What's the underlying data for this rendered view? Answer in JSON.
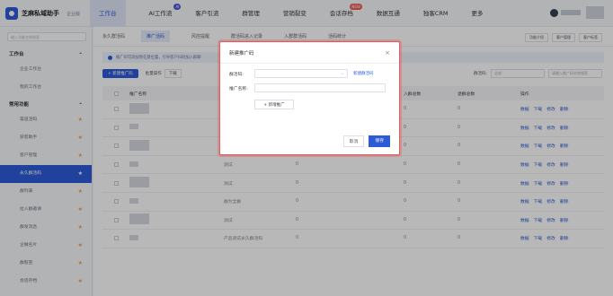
{
  "app": {
    "name": "芝麻私域助手",
    "subtitle": "企业版"
  },
  "top_nav": [
    {
      "label": "工作台",
      "badge": ""
    },
    {
      "label": "AI工作流",
      "badge": "AI"
    },
    {
      "label": "客户引流",
      "badge": ""
    },
    {
      "label": "群管理",
      "badge": ""
    },
    {
      "label": "营销裂变",
      "badge": ""
    },
    {
      "label": "会话存档",
      "badge": "NEW"
    },
    {
      "label": "数据互通",
      "badge": ""
    },
    {
      "label": "独客CRM",
      "badge": ""
    },
    {
      "label": "更多",
      "badge": ""
    }
  ],
  "sidebar": {
    "search_placeholder": "输入功能名称搜索",
    "groups": [
      {
        "title": "工作台",
        "items": [
          "企业工作台",
          "我的工作台"
        ]
      },
      {
        "title": "常用功能",
        "items": [
          "渠道活码",
          "获客助手",
          "客户管理",
          "永久群活码",
          "群列表",
          "拉人群邀请",
          "群发消息",
          "企微名片",
          "群裂变",
          "会话存档"
        ]
      }
    ],
    "active_item": "永久群活码"
  },
  "content": {
    "tabs": [
      "永久群活码",
      "推广活码",
      "风控提醒",
      "群活码进入记录",
      "入群群活码",
      "活码统计"
    ],
    "right_links": [
      "功能介绍",
      "客户管理",
      "客户标签"
    ],
    "notice": "推广码可添加到任意位置，引导客户扫码加入群聊",
    "toolbar": {
      "new_button": "+ 新建推广码",
      "batch_label": "批量操作",
      "download_label": "下载",
      "filter_label": "群活码:",
      "filter_value": "全部",
      "search_placeholder": "请输入推广码名称搜索"
    },
    "columns": [
      "推广名称",
      "群活码",
      "扫码人数",
      "入群总数",
      "退群总数",
      "操作"
    ],
    "rows": [
      {
        "name": "",
        "code": "测试",
        "scan": "0",
        "join": "0",
        "quit": "0"
      },
      {
        "name": "",
        "code": "测试",
        "scan": "0",
        "join": "0",
        "quit": "0"
      },
      {
        "name": "",
        "code": "测试",
        "scan": "0",
        "join": "0",
        "quit": "0"
      },
      {
        "name": "",
        "code": "测试",
        "scan": "0",
        "join": "0",
        "quit": "0"
      },
      {
        "name": "",
        "code": "测试",
        "scan": "0",
        "join": "0",
        "quit": "0"
      },
      {
        "name": "",
        "code": "群为全群",
        "scan": "0",
        "join": "0",
        "quit": "0"
      },
      {
        "name": "",
        "code": "测试",
        "scan": "0",
        "join": "0",
        "quit": "0"
      },
      {
        "name": "",
        "code": "产品测试永久群活码",
        "scan": "0",
        "join": "0",
        "quit": "0"
      }
    ],
    "actions": [
      "数据",
      "下载",
      "修改",
      "删除"
    ]
  },
  "modal": {
    "title": "新建推广码",
    "field1_label": "群活码:",
    "field1_link": "新建群活码",
    "field2_label": "推广名称:",
    "add_button": "+ 新增推广",
    "cancel": "取消",
    "ok": "保存"
  }
}
